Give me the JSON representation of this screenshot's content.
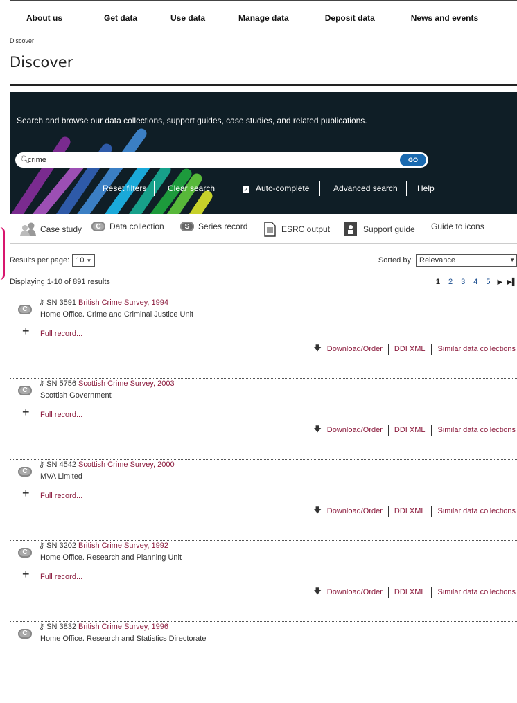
{
  "nav": [
    "About us",
    "Get data",
    "Use data",
    "Manage data",
    "Deposit data",
    "News and events"
  ],
  "breadcrumb": "Discover",
  "page_title": "Discover",
  "hero": {
    "text": "Search and browse our data collections, support guides, case studies, and related publications.",
    "search_value": "crime",
    "go_label": "GO",
    "links": {
      "reset": "Reset filters",
      "clear": "Clear search",
      "autocomplete": "Auto-complete",
      "advanced": "Advanced search",
      "help": "Help"
    },
    "colors": [
      "#7a2b8f",
      "#9c4fb4",
      "#2e5aa8",
      "#3b7fc4",
      "#1aa9d9",
      "#17a08a",
      "#1d9a3c",
      "#58b83a",
      "#c7d12a"
    ]
  },
  "icon_bar": {
    "case_study": "Case study",
    "data_collection": "Data collection",
    "series_record": "Series record",
    "esrc_output": "ESRC output",
    "support_guide": "Support guide",
    "guide_to_icons": "Guide to icons"
  },
  "results_per_page_label": "Results per page:",
  "results_per_page_value": "10",
  "sorted_by_label": "Sorted by:",
  "sorted_by_value": "Relevance",
  "displaying": "Displaying 1-10 of 891 results",
  "pager": [
    "1",
    "2",
    "3",
    "4",
    "5"
  ],
  "results": [
    {
      "sn": "SN 3591",
      "title": "British Crime Survey, 1994",
      "depositor": "Home Office. Crime and Criminal Justice Unit"
    },
    {
      "sn": "SN 5756",
      "title": "Scottish Crime Survey, 2003",
      "depositor": "Scottish Government"
    },
    {
      "sn": "SN 4542",
      "title": "Scottish Crime Survey, 2000",
      "depositor": "MVA Limited"
    },
    {
      "sn": "SN 3202",
      "title": "British Crime Survey, 1992",
      "depositor": "Home Office. Research and Planning Unit"
    },
    {
      "sn": "SN 3832",
      "title": "British Crime Survey, 1996",
      "depositor": "Home Office. Research and Statistics Directorate"
    }
  ],
  "result_links": {
    "full_record": "Full record...",
    "download": "Download/Order",
    "ddi": "DDI XML",
    "similar": "Similar data collections"
  }
}
